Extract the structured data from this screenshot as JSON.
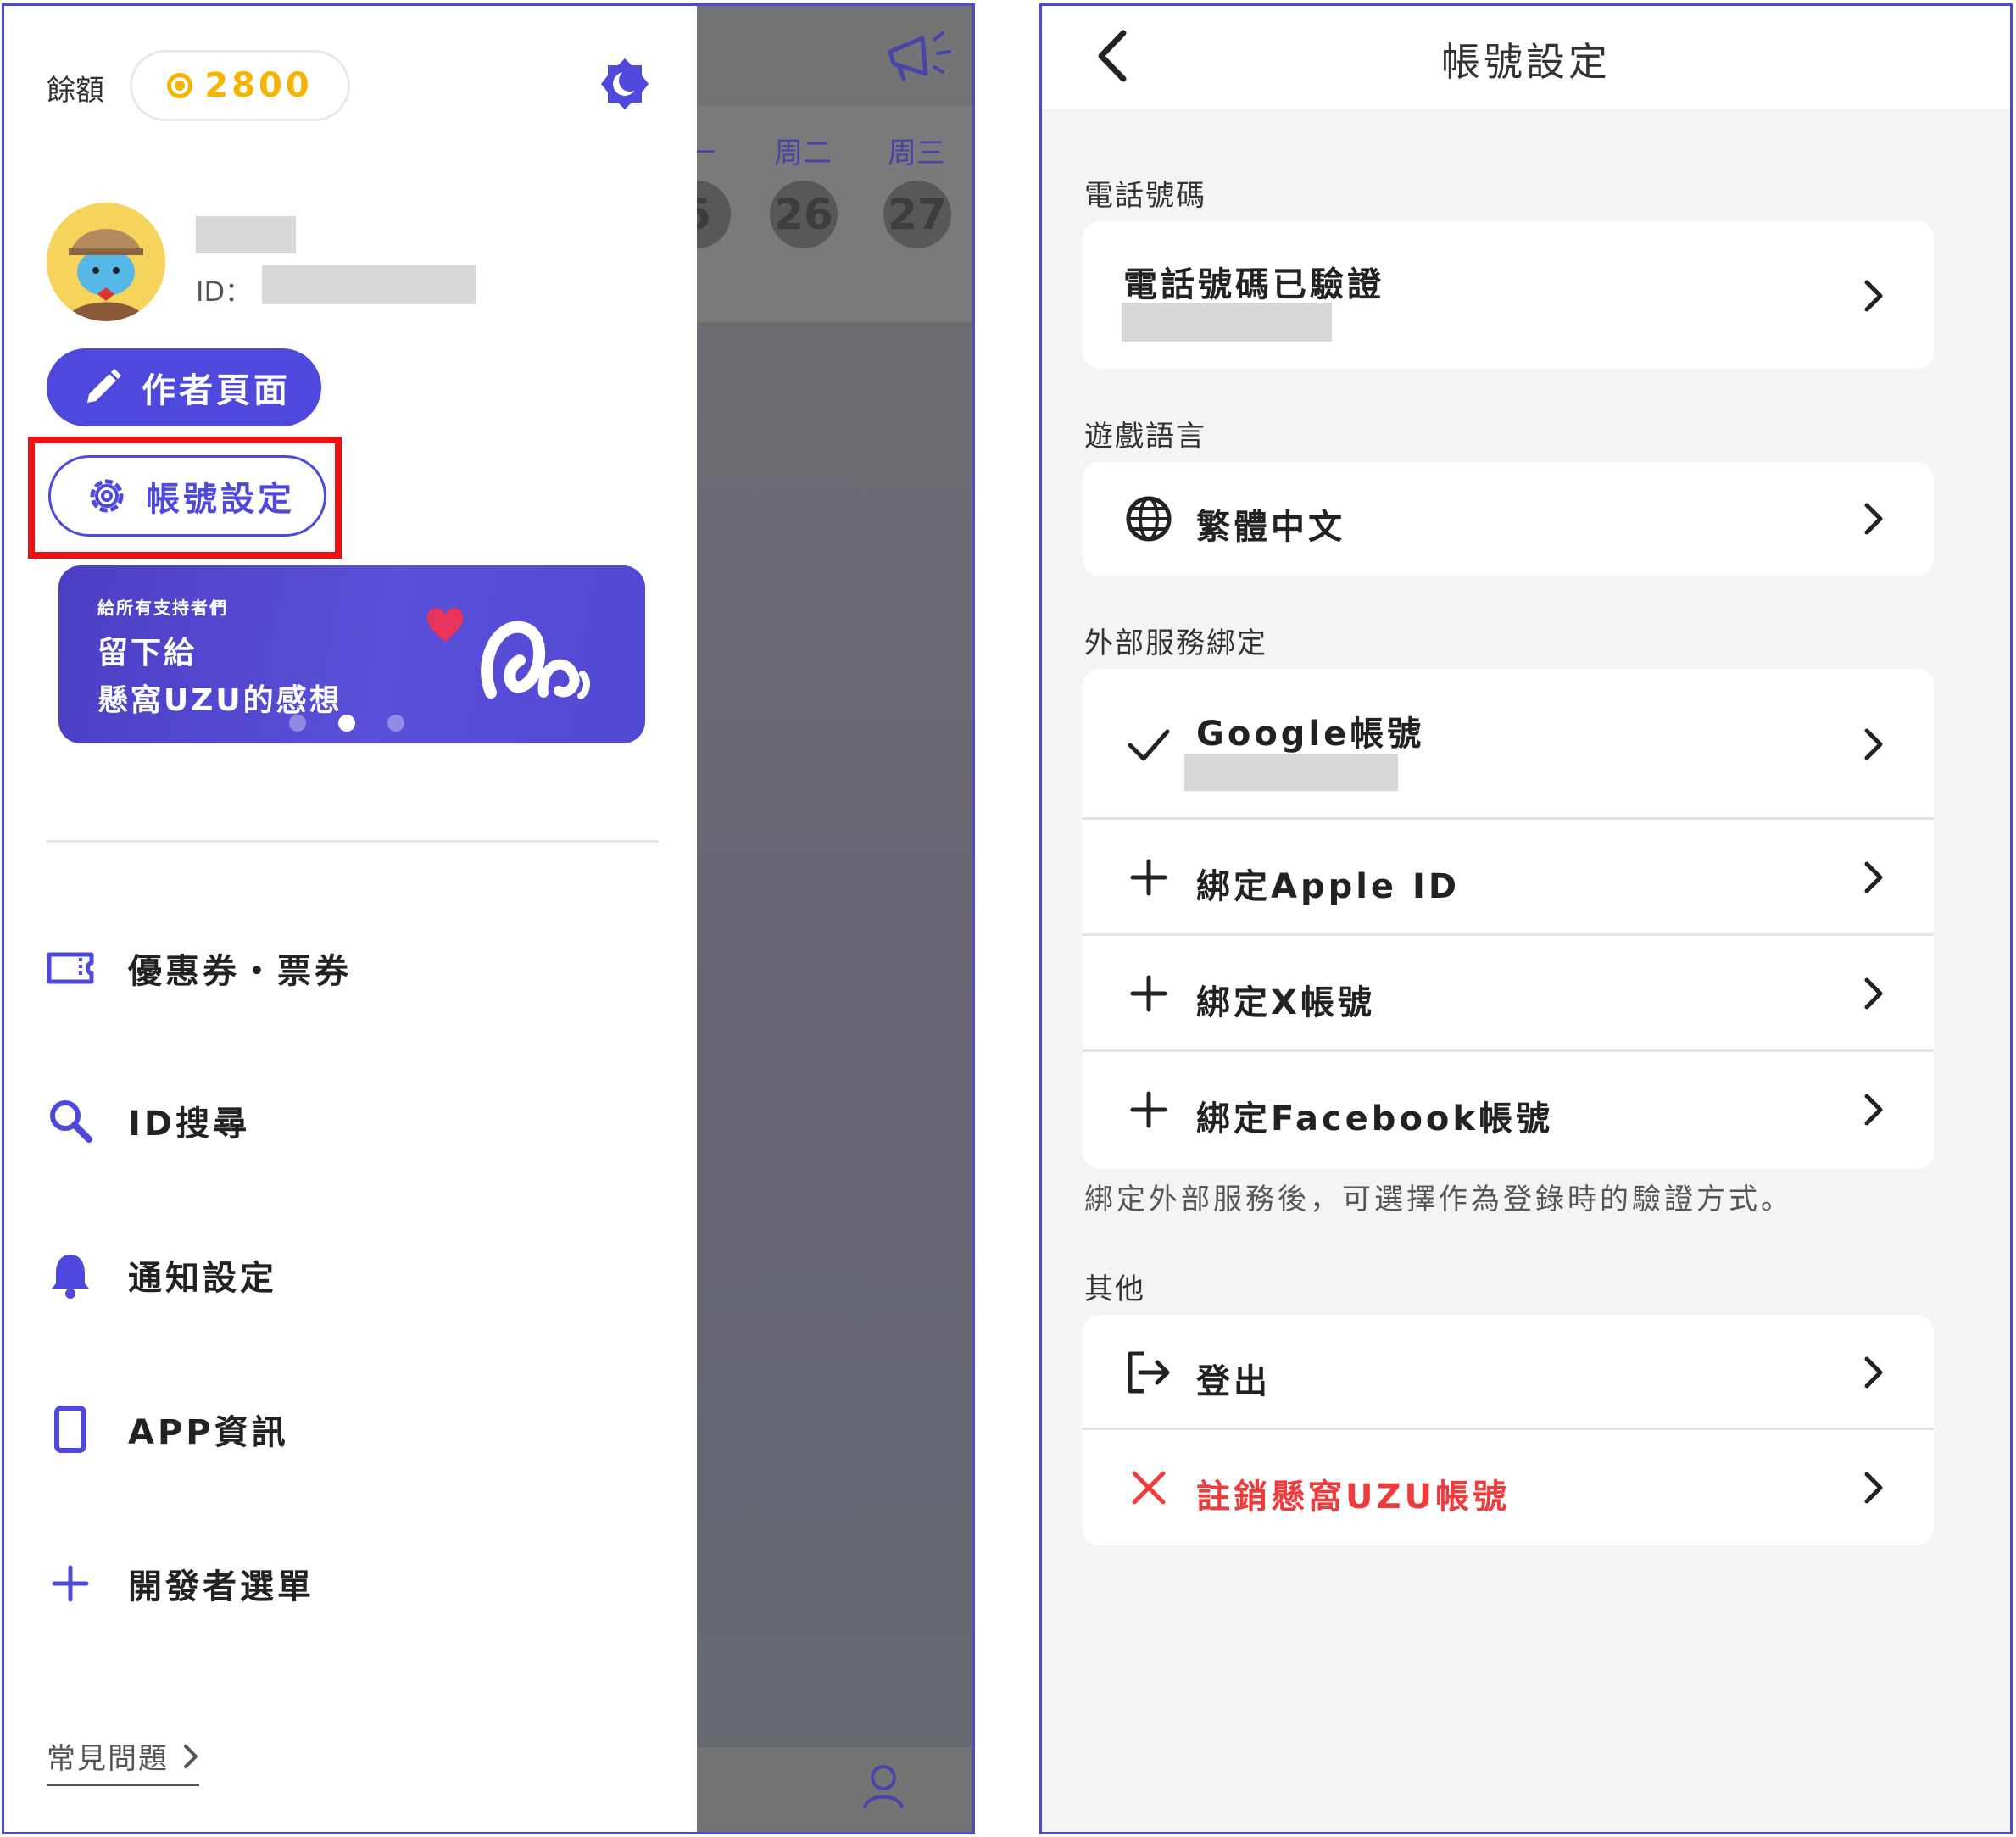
{
  "drawer": {
    "balance_label": "餘額",
    "balance_value": "2800",
    "id_label": "ID：",
    "author_button": "作者頁面",
    "settings_button": "帳號設定",
    "banner": {
      "small_text": "給所有支持者們",
      "line1": "留下給",
      "line2": "懸窩UZU的感想"
    },
    "menu": [
      {
        "label": "優惠券・票券",
        "icon": "ticket-icon"
      },
      {
        "label": "ID搜尋",
        "icon": "search-icon"
      },
      {
        "label": "通知設定",
        "icon": "bell-icon"
      },
      {
        "label": "APP資訊",
        "icon": "phone-icon"
      },
      {
        "label": "開發者選單",
        "icon": "plus-icon"
      }
    ],
    "faq": "常見問題"
  },
  "background_screen": {
    "days": [
      "一",
      "周二",
      "周三"
    ],
    "dates": [
      "5",
      "26",
      "27"
    ]
  },
  "settings": {
    "title": "帳號設定",
    "sections": {
      "phone": "電話號碼",
      "language": "遊戲語言",
      "external": "外部服務綁定",
      "other": "其他"
    },
    "phone_verified": "電話號碼已驗證",
    "language_value": "繁體中文",
    "google": "Google帳號",
    "apple": "綁定Apple ID",
    "x": "綁定X帳號",
    "facebook": "綁定Facebook帳號",
    "external_note": "綁定外部服務後，可選擇作為登錄時的驗證方式。",
    "logout": "登出",
    "delete": "註銷懸窩UZU帳號"
  },
  "colors": {
    "accent": "#4f48dc",
    "coin": "#f5b400",
    "highlight": "#ee1111",
    "danger": "#ee3b3b"
  }
}
